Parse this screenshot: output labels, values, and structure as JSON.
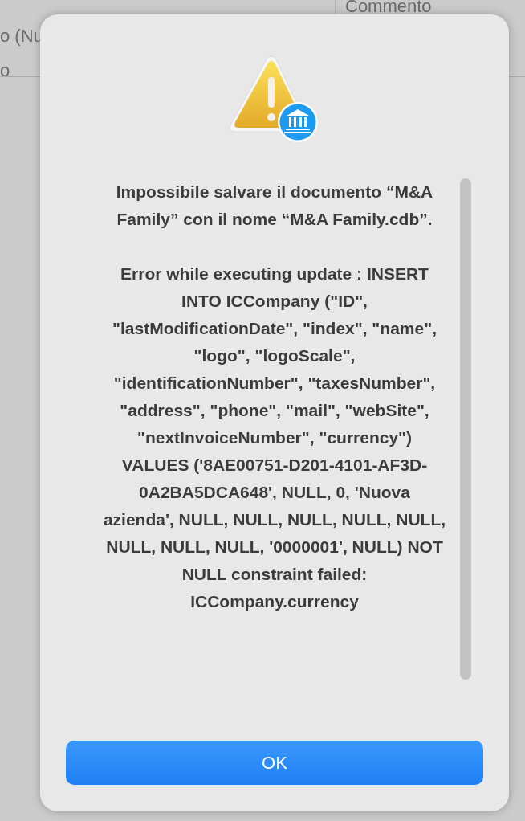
{
  "background": {
    "column_header": "Commento",
    "cell_1": "o (Nu",
    "cell_2": "o"
  },
  "alert": {
    "paragraphs": [
      "Impossibile salvare il documento “M&A Family” con il nome “M&A Family.cdb”.",
      "Error while executing update : INSERT INTO ICCompany (\"ID\", \"lastModificationDate\", \"index\", \"name\", \"logo\", \"logoScale\", \"identificationNumber\", \"taxesNumber\", \"address\", \"phone\", \"mail\", \"webSite\", \"nextInvoiceNumber\", \"currency\") VALUES ('8AE00751-D201-4101-AF3D-0A2BA5DCA648', NULL, 0, 'Nuova azienda', NULL, NULL, NULL, NULL, NULL, NULL, NULL, NULL, '0000001', NULL) NOT NULL constraint failed: ICCompany.currency"
    ],
    "button": "OK"
  }
}
